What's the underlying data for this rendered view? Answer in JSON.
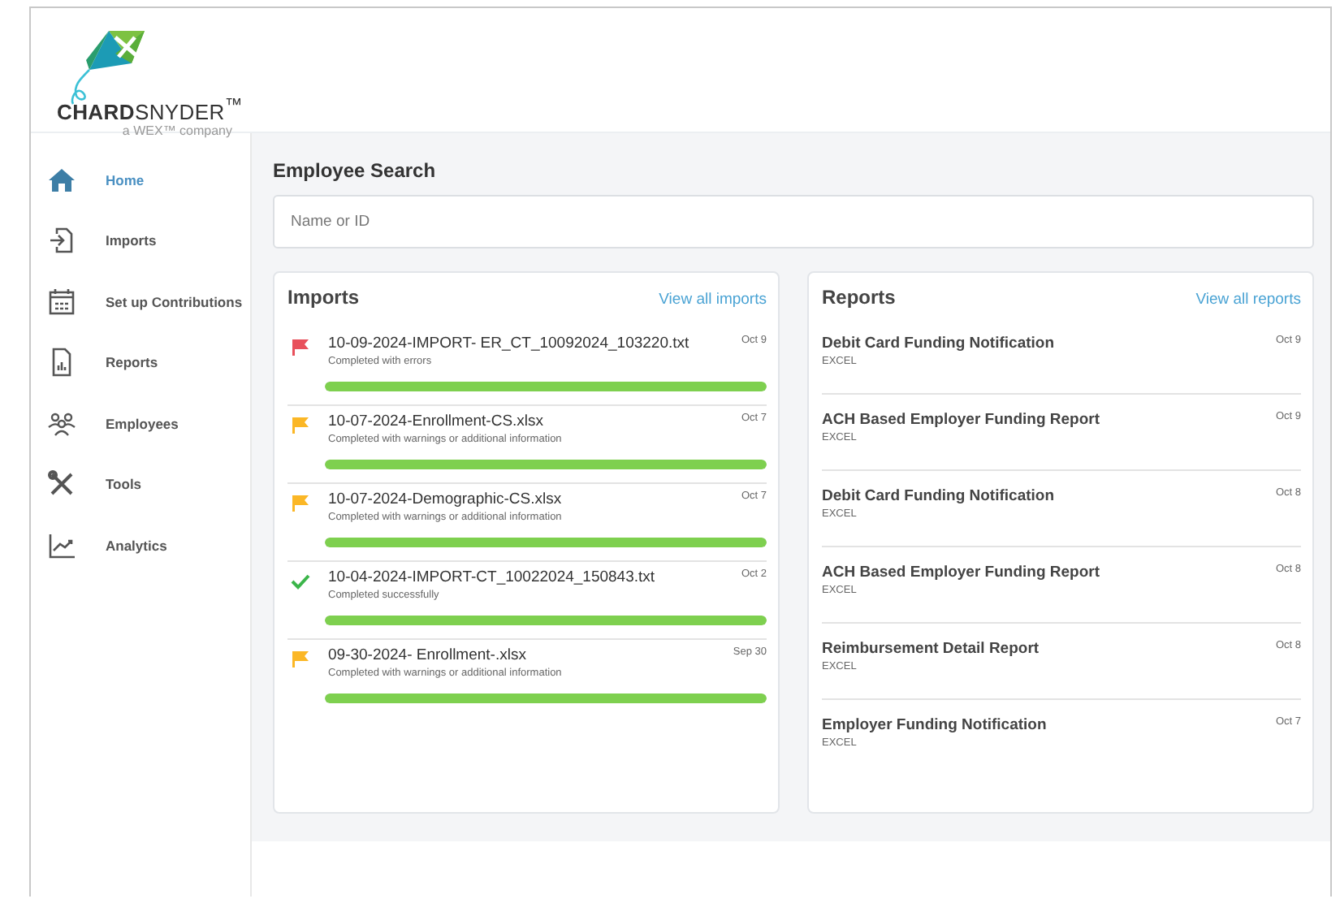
{
  "logo": {
    "wordmark": "**CHARD**SNYDER$^{™}$",
    "tagline": "a WEX™ company"
  },
  "sidebar": {
    "items": [
      {
        "label": "Home",
        "kind": "home",
        "selected": true
      },
      {
        "label": "Imports",
        "kind": "import",
        "selected": false
      },
      {
        "label": "Set up Contributions",
        "kind": "calendar",
        "selected": false
      },
      {
        "label": "Reports",
        "kind": "report",
        "selected": false
      },
      {
        "label": "Employees",
        "kind": "people",
        "selected": false
      },
      {
        "label": "Tools",
        "kind": "tools",
        "selected": false
      },
      {
        "label": "Analytics",
        "kind": "chart",
        "selected": false
      }
    ]
  },
  "employee_search": {
    "title": "Employee Search",
    "placeholder": "Name or ID"
  },
  "imports": {
    "title": "Imports",
    "link": "View all imports",
    "items": [
      {
        "name": "10-09-2024-IMPORT- ER_CT_10092024_103220.txt",
        "status": "Completed with errors",
        "kind": "error",
        "date": "Oct 9",
        "level": 1
      },
      {
        "name": "10-07-2024-Enrollment-CS.xlsx",
        "status": "Completed with warnings or additional information",
        "kind": "warning",
        "date": "Oct 7",
        "level": 1
      },
      {
        "name": "10-07-2024-Demographic-CS.xlsx",
        "status": "Completed with warnings or additional information",
        "kind": "warning",
        "date": "Oct 7",
        "level": 1
      },
      {
        "name": "10-04-2024-IMPORT-CT_10022024_150843.txt",
        "status": "Completed successfully",
        "kind": "success",
        "date": "Oct 2",
        "level": 1
      },
      {
        "name": "09-30-2024- Enrollment-.xlsx",
        "status": "Completed with warnings or additional information",
        "kind": "warning",
        "date": "Sep 30",
        "level": 1
      }
    ]
  },
  "reports": {
    "title": "Reports",
    "link": "View all reports",
    "items": [
      {
        "name": "Debit Card Funding Notification",
        "format": "EXCEL",
        "date": "Oct 9"
      },
      {
        "name": "ACH Based Employer Funding Report",
        "format": "EXCEL",
        "date": "Oct 9"
      },
      {
        "name": "Debit Card Funding Notification",
        "format": "EXCEL",
        "date": "Oct 8"
      },
      {
        "name": "ACH Based Employer Funding Report",
        "format": "EXCEL",
        "date": "Oct 8"
      },
      {
        "name": "Reimbursement Detail Report",
        "format": "EXCEL",
        "date": "Oct 8"
      },
      {
        "name": "Employer Funding Notification",
        "format": "EXCEL",
        "date": "Oct 7"
      }
    ]
  }
}
